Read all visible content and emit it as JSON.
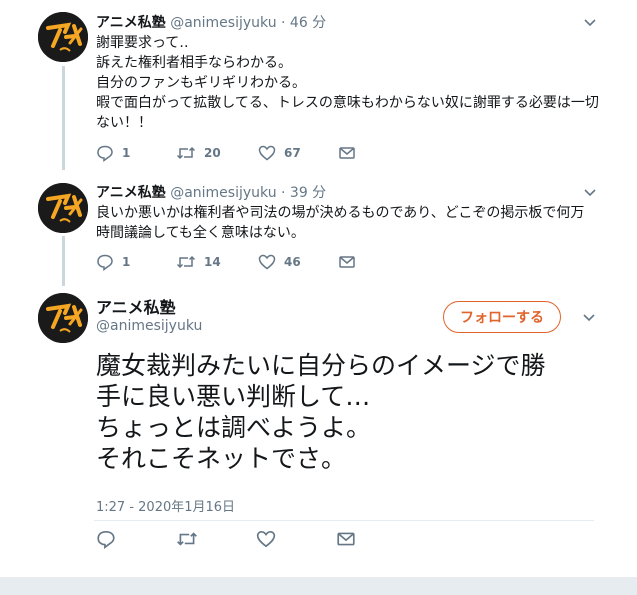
{
  "tweets": [
    {
      "display_name": "アニメ私塾",
      "handle": "@animesijyuku",
      "dot": "·",
      "time": "46 分",
      "lines": [
        "謝罪要求って‥",
        "訴えた権利者相手ならわかる。",
        "自分のファンもギリギリわかる。",
        "暇で面白がって拡散してる、トレスの意味もわからない奴に謝罪する必要は一切",
        "ない！！"
      ],
      "reply_count": "1",
      "retweet_count": "20",
      "like_count": "67"
    },
    {
      "display_name": "アニメ私塾",
      "handle": "@animesijyuku",
      "dot": "·",
      "time": "39 分",
      "lines": [
        "良いか悪いかは権利者や司法の場が決めるものであり、どこぞの掲示板で何万",
        "時間議論しても全く意味はない。"
      ],
      "reply_count": "1",
      "retweet_count": "14",
      "like_count": "46"
    }
  ],
  "main_tweet": {
    "display_name": "アニメ私塾",
    "handle": "@animesijyuku",
    "follow_label": "フォローする",
    "lines": [
      "魔女裁判みたいに自分らのイメージで勝",
      "手に良い悪い判断して…",
      "ちょっとは調べようよ。",
      "それこそネットでさ。"
    ],
    "timestamp": "1:27 - 2020年1月16日"
  },
  "avatar_logo_text": "アニメ",
  "colors": {
    "accent_orange": "#e0642c",
    "icon_gray": "#657786",
    "divider": "#e6ecf0",
    "avatar_bg": "#1a1a1a",
    "logo_orange": "#f5a623"
  },
  "icons": [
    "reply-icon",
    "retweet-icon",
    "like-icon",
    "message-icon",
    "chevron-down-icon"
  ]
}
